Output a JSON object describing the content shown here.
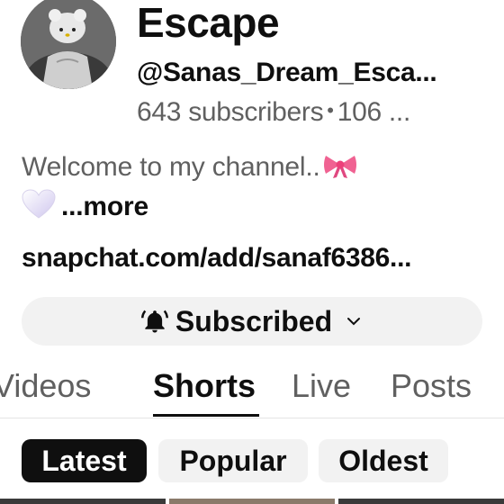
{
  "channel": {
    "name": "Escape",
    "handle": "@Sanas_Dream_Esca...",
    "subscribers": "643 subscribers",
    "separator": "•",
    "videos": "106 ...",
    "description": "Welcome to my channel..",
    "more_label": "...more",
    "link": "snapchat.com/add/sanaf6386..."
  },
  "subscribe_button": {
    "label": "Subscribed",
    "icon": "bell-ringing-icon",
    "dropdown_icon": "chevron-down-icon"
  },
  "tabs": [
    {
      "label": "Videos",
      "active": false
    },
    {
      "label": "Shorts",
      "active": true
    },
    {
      "label": "Live",
      "active": false
    },
    {
      "label": "Posts",
      "active": false
    }
  ],
  "filters": [
    {
      "label": "Latest",
      "selected": true
    },
    {
      "label": "Popular",
      "selected": false
    },
    {
      "label": "Oldest",
      "selected": false
    }
  ],
  "icons": {
    "description_emoji_1": "pink-bow-icon",
    "description_emoji_2": "white-heart-icon",
    "avatar": "avatar"
  },
  "colors": {
    "text_primary": "#0f0f0f",
    "text_secondary": "#606060",
    "chip_bg": "#f2f2f2",
    "chip_selected_bg": "#0f0f0f",
    "bow": "#f06292"
  }
}
